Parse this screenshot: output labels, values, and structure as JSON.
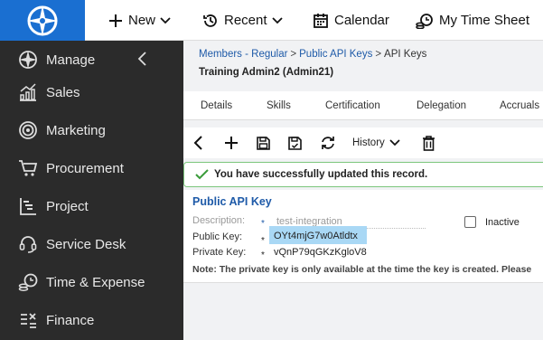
{
  "topbar": {
    "new_label": "New",
    "recent_label": "Recent",
    "calendar_label": "Calendar",
    "timesheet_label": "My Time Sheet"
  },
  "sidebar": {
    "items": [
      {
        "label": "Manage",
        "icon": "compass-icon"
      },
      {
        "label": "Sales",
        "icon": "chart-growth-icon"
      },
      {
        "label": "Marketing",
        "icon": "target-icon"
      },
      {
        "label": "Procurement",
        "icon": "cart-icon"
      },
      {
        "label": "Project",
        "icon": "gantt-icon"
      },
      {
        "label": "Service Desk",
        "icon": "headset-icon"
      },
      {
        "label": "Time & Expense",
        "icon": "clock-coins-icon"
      },
      {
        "label": "Finance",
        "icon": "calculator-icon"
      }
    ]
  },
  "breadcrumb": {
    "item1": "Members - Regular",
    "item2": "Public API Keys",
    "item3": "API Keys"
  },
  "record_title": "Training Admin2 (Admin21)",
  "tabs": [
    "Details",
    "Skills",
    "Certification",
    "Delegation",
    "Accruals"
  ],
  "toolbar": {
    "history_label": "History"
  },
  "success_message": "You have successfully updated this record.",
  "form": {
    "section_title": "Public API Key",
    "description_label": "Description:",
    "description_value": "test-integration",
    "public_key_label": "Public Key:",
    "public_key_value": "OYt4mjG7w0Atldtx",
    "private_key_label": "Private Key:",
    "private_key_value": "vQnP79qGKzKgloV8",
    "inactive_label": "Inactive",
    "required_marker": "*",
    "note": "Note: The private key is only available at the time the key is created. Please"
  },
  "colors": {
    "brand": "#1a6fd1",
    "sidebar_bg": "#2b2b2b",
    "link": "#1e5aa8",
    "success_border": "#7cc67c",
    "selection": "#a9d8f5"
  }
}
